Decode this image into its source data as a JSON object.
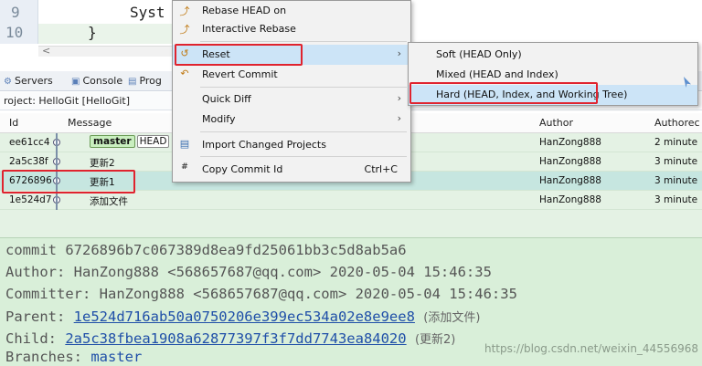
{
  "editor": {
    "line_numbers": [
      "9",
      "10"
    ],
    "code_line_1": "Syst",
    "code_line_2": "}",
    "scroll_arrow": "<"
  },
  "view_tabs": [
    {
      "label": "Servers",
      "icon": "servers-icon"
    },
    {
      "label": "Console",
      "icon": "console-icon"
    },
    {
      "label": "Prog",
      "icon": "progress-icon"
    }
  ],
  "project_label": "roject: HelloGit [HelloGit]",
  "table": {
    "headers": {
      "id": "Id",
      "message": "Message",
      "author": "Author",
      "authored": "Authorec"
    },
    "rows": [
      {
        "id": "ee61cc4",
        "badge_master": "master",
        "badge_head": "HEAD",
        "message": "",
        "author": "HanZong888",
        "time": "2 minute"
      },
      {
        "id": "2a5c38f",
        "message": "更新2",
        "author": "HanZong888",
        "time": "3 minute"
      },
      {
        "id": "6726896",
        "message": "更新1",
        "author": "HanZong888",
        "time": "3 minute",
        "selected": true
      },
      {
        "id": "1e524d7",
        "message": "添加文件",
        "author": "HanZong888",
        "time": "3 minute"
      }
    ]
  },
  "context_menu": {
    "rebase_head": "Rebase HEAD on",
    "interactive_rebase": "Interactive Rebase",
    "reset": "Reset",
    "revert_commit": "Revert Commit",
    "quick_diff": "Quick Diff",
    "modify": "Modify",
    "import_changed_projects": "Import Changed Projects",
    "copy_commit_id": "Copy Commit Id",
    "copy_commit_id_shortcut": "Ctrl+C",
    "submenu_arrow": "›"
  },
  "reset_submenu": {
    "soft": "Soft (HEAD Only)",
    "mixed": "Mixed (HEAD and Index)",
    "hard": "Hard (HEAD, Index, and Working Tree)"
  },
  "details": {
    "commit": "commit 6726896b7c067389d8ea9fd25061bb3c5d8ab5a6",
    "author": "Author: HanZong888 <568657687@qq.com> 2020-05-04 15:46:35",
    "committer": "Committer: HanZong888 <568657687@qq.com> 2020-05-04 15:46:35",
    "parent_prefix": "Parent: ",
    "parent_hash": "1e524d716ab50a0750206e399ec534a02e8e9ee8",
    "parent_note": "(添加文件)",
    "child_prefix": "Child: ",
    "child_hash": "2a5c38fbea1908a62877397f3f7dd7743ea84020",
    "child_note": "(更新2)",
    "branches_prefix": "Branches: ",
    "branches_value": "master"
  },
  "watermark": "https://blog.csdn.net/weixin_44556968",
  "colors": {
    "menu_highlight": "#cce4f7",
    "annotation_red": "#e0232e",
    "row_green": "#e4f2e4",
    "details_green": "#d9efd9",
    "link_blue": "#1f4fa8"
  }
}
